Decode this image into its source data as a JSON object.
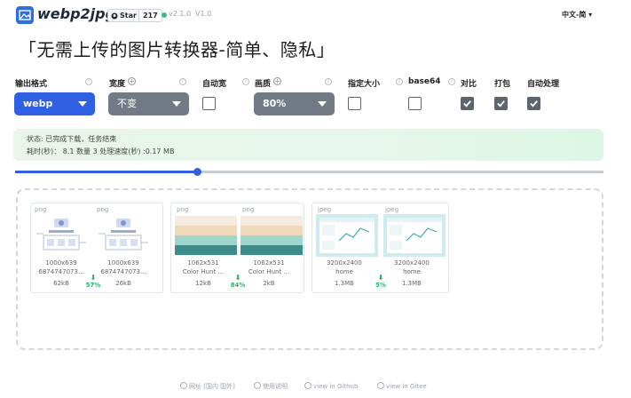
{
  "header": {
    "brand": "webp2jpg",
    "github_star_label": "Star",
    "github_star_count": "217",
    "version": "v2.1.0",
    "version_alt": "V1.0",
    "language": "中文-简 ▾"
  },
  "title": "「无需上传的图片转换器-简单、隐私」",
  "options": {
    "output_format": {
      "label": "输出格式",
      "value": "webp"
    },
    "width": {
      "label": "宽度",
      "value": "不变"
    },
    "auto_width": {
      "label": "自动宽",
      "checked": false
    },
    "quality": {
      "label": "画质",
      "value": "80%"
    },
    "set_size": {
      "label": "指定大小",
      "checked": false
    },
    "base64": {
      "label": "base64",
      "checked": false
    },
    "compare": {
      "label": "对比",
      "checked": true
    },
    "pack": {
      "label": "打包",
      "checked": true
    },
    "auto_process": {
      "label": "自动处理",
      "checked": true
    }
  },
  "status": {
    "line1": "状态: 已完成下载，任务结束",
    "line2": "耗时(秒)： 8.1 数量 3 处理速度(秒) :0.17 MB"
  },
  "slider": {
    "value_fraction": 0.31
  },
  "images": [
    {
      "original": {
        "format": "png",
        "dims": "1000x639",
        "name": "6874747073...",
        "size": "62kB"
      },
      "converted": {
        "format": "png",
        "dims": "1000x639",
        "name": "6874747073...",
        "size": "26kB"
      },
      "ratio": "57%"
    },
    {
      "original": {
        "format": "png",
        "dims": "1062x531",
        "name": "Color Hunt ...",
        "size": "12kB"
      },
      "converted": {
        "format": "png",
        "dims": "1062x531",
        "name": "Color Hunt ...",
        "size": "2kB"
      },
      "ratio": "84%"
    },
    {
      "original": {
        "format": "jpeg",
        "dims": "3200x2400",
        "name": "home",
        "size": "1.3MB"
      },
      "converted": {
        "format": "jpeg",
        "dims": "3200x2400",
        "name": "home",
        "size": "1.3MB"
      },
      "ratio": "5%"
    }
  ],
  "footer": {
    "site": "网址 [国内 国外]",
    "guide": "使用说明",
    "github": "view in Github",
    "gitee": "view in Gitee"
  },
  "colors": {
    "accent": "#2f5fe3",
    "select_gray": "#727b85",
    "success": "#2bb36a"
  }
}
